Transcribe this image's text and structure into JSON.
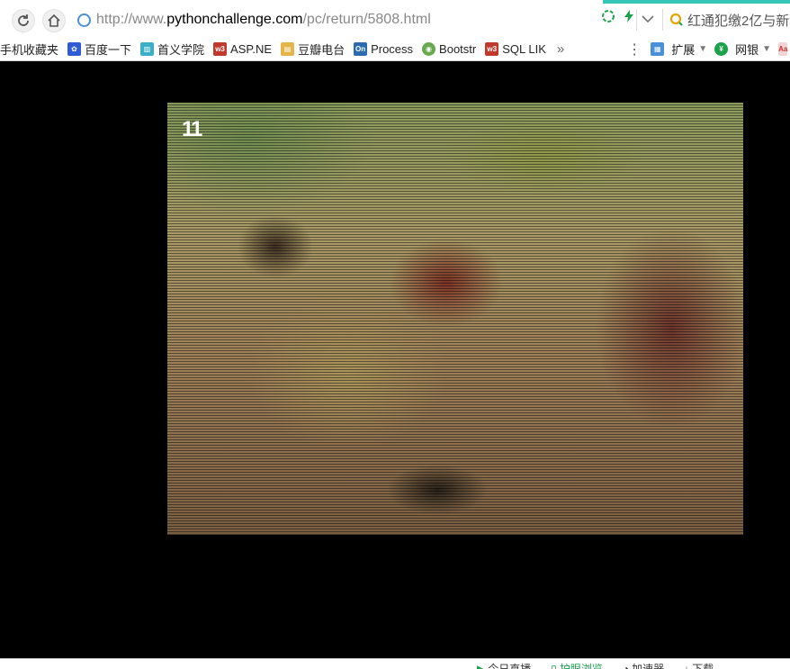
{
  "browser": {
    "url_prefix": "http://www.",
    "url_host": "pythonchallenge.com",
    "url_path": "/pc/return/5808.html",
    "search_text": "红通犯缴2亿与新",
    "accent_color": "#35c5b4"
  },
  "bookmarks": {
    "items": [
      {
        "label": "手机收藏夹",
        "icon": "none"
      },
      {
        "label": "百度一下",
        "icon": "paw-icon"
      },
      {
        "label": "首义学院",
        "icon": "school-icon"
      },
      {
        "label": "ASP.NE",
        "icon": "w3-icon"
      },
      {
        "label": "豆瓣电台",
        "icon": "radio-icon"
      },
      {
        "label": "Process",
        "icon": "on-icon"
      },
      {
        "label": "Bootstr",
        "icon": "bootstrap-icon"
      },
      {
        "label": "SQL LIK",
        "icon": "w3-icon"
      }
    ],
    "more": "»",
    "extensions": "扩展",
    "netbank": "网银",
    "kebab": "⋮"
  },
  "video": {
    "overlay_number": "11"
  },
  "status": {
    "items": [
      "今日直播",
      "护眼浏览",
      "加速器",
      "下载"
    ]
  }
}
